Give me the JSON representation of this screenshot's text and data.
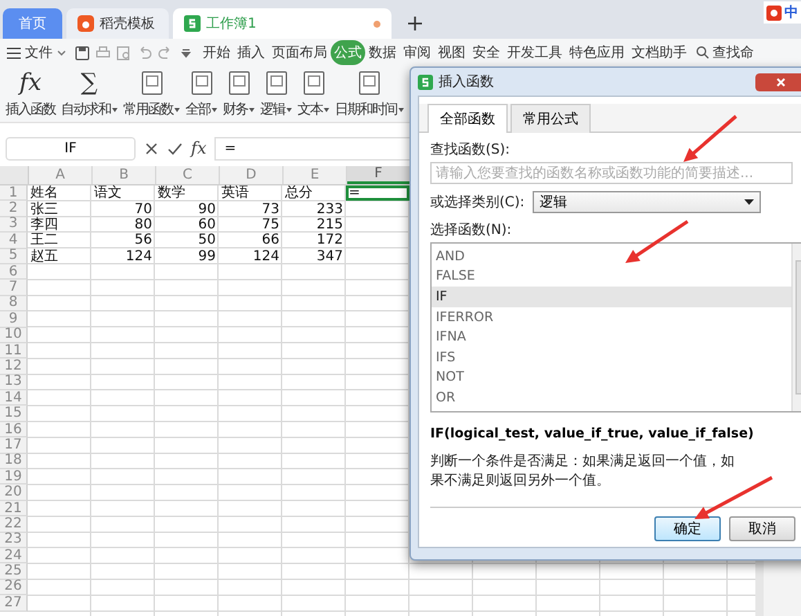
{
  "tabs": [
    {
      "label": "首页",
      "selected": false,
      "kind": "home"
    },
    {
      "label": "稻壳模板",
      "selected": false,
      "kind": "docer"
    },
    {
      "label": "工作簿1",
      "selected": true,
      "kind": "sheet"
    }
  ],
  "ime_label": "中",
  "menu": {
    "file": "文件",
    "items": [
      {
        "label": "开始",
        "selected": false
      },
      {
        "label": "插入",
        "selected": false
      },
      {
        "label": "页面布局",
        "selected": false
      },
      {
        "label": "公式",
        "selected": true
      },
      {
        "label": "数据",
        "selected": false
      },
      {
        "label": "审阅",
        "selected": false
      },
      {
        "label": "视图",
        "selected": false
      },
      {
        "label": "安全",
        "selected": false
      },
      {
        "label": "开发工具",
        "selected": false
      },
      {
        "label": "特色应用",
        "selected": false
      },
      {
        "label": "文档助手",
        "selected": false
      }
    ],
    "search": "查找命"
  },
  "ribbon": [
    {
      "label": "插入函数",
      "kind": "glyph",
      "glyph": "fx",
      "dropdown": false
    },
    {
      "label": "自动求和",
      "kind": "glyph",
      "glyph": "∑",
      "dropdown": true
    },
    {
      "label": "常用函数",
      "kind": "doc",
      "dropdown": true
    },
    {
      "label": "全部",
      "kind": "doc",
      "dropdown": true
    },
    {
      "label": "财务",
      "kind": "doc",
      "dropdown": true
    },
    {
      "label": "逻辑",
      "kind": "doc",
      "dropdown": true
    },
    {
      "label": "文本",
      "kind": "doc",
      "dropdown": true
    },
    {
      "label": "日期和时间",
      "kind": "doc",
      "dropdown": true
    }
  ],
  "formula_bar": {
    "name_box": "IF",
    "fx": "fx",
    "value": "="
  },
  "sheet": {
    "columns": [
      {
        "label": "A",
        "selected": false
      },
      {
        "label": "B",
        "selected": false
      },
      {
        "label": "C",
        "selected": false
      },
      {
        "label": "D",
        "selected": false
      },
      {
        "label": "E",
        "selected": false
      },
      {
        "label": "F",
        "selected": true
      }
    ],
    "rows": [
      {
        "number": "1",
        "kind": "text",
        "cells": [
          {
            "text": "姓名",
            "selected": false
          },
          {
            "text": "语文",
            "selected": false
          },
          {
            "text": "数学",
            "selected": false
          },
          {
            "text": "英语",
            "selected": false
          },
          {
            "text": "总分",
            "selected": false
          },
          {
            "text": "=",
            "selected": true
          }
        ]
      },
      {
        "number": "2",
        "kind": "record",
        "cells": [
          {
            "text": "张三",
            "selected": false
          },
          {
            "text": "70",
            "selected": false
          },
          {
            "text": "90",
            "selected": false
          },
          {
            "text": "73",
            "selected": false
          },
          {
            "text": "233",
            "selected": false
          }
        ]
      },
      {
        "number": "3",
        "kind": "record",
        "cells": [
          {
            "text": "李四",
            "selected": false
          },
          {
            "text": "80",
            "selected": false
          },
          {
            "text": "60",
            "selected": false
          },
          {
            "text": "75",
            "selected": false
          },
          {
            "text": "215",
            "selected": false
          }
        ]
      },
      {
        "number": "4",
        "kind": "record",
        "cells": [
          {
            "text": "王二",
            "selected": false
          },
          {
            "text": "56",
            "selected": false
          },
          {
            "text": "50",
            "selected": false
          },
          {
            "text": "66",
            "selected": false
          },
          {
            "text": "172",
            "selected": false
          }
        ]
      },
      {
        "number": "5",
        "kind": "record",
        "cells": [
          {
            "text": "赵五",
            "selected": false
          },
          {
            "text": "124",
            "selected": false
          },
          {
            "text": "99",
            "selected": false
          },
          {
            "text": "124",
            "selected": false
          },
          {
            "text": "347",
            "selected": false
          }
        ]
      },
      {
        "number": "6"
      },
      {
        "number": "7"
      },
      {
        "number": "8"
      },
      {
        "number": "9"
      },
      {
        "number": "10"
      },
      {
        "number": "11"
      },
      {
        "number": "12"
      },
      {
        "number": "13"
      },
      {
        "number": "14"
      },
      {
        "number": "15"
      },
      {
        "number": "16"
      },
      {
        "number": "17"
      },
      {
        "number": "18"
      },
      {
        "number": "19"
      },
      {
        "number": "20"
      },
      {
        "number": "21"
      },
      {
        "number": "22"
      },
      {
        "number": "23"
      },
      {
        "number": "24"
      },
      {
        "number": "25"
      },
      {
        "number": "26"
      },
      {
        "number": "27"
      }
    ]
  },
  "dialog": {
    "title": "插入函数",
    "tabs": [
      {
        "label": "全部函数",
        "selected": true
      },
      {
        "label": "常用公式",
        "selected": false
      }
    ],
    "search_label": "查找函数(S):",
    "search": {
      "placeholder": "请输入您要查找的函数名称或函数功能的简要描述..."
    },
    "category_label": "或选择类别(C):",
    "category": "逻辑",
    "list_label": "选择函数(N):",
    "functions": [
      {
        "name": "AND",
        "selected": false
      },
      {
        "name": "FALSE",
        "selected": false
      },
      {
        "name": "IF",
        "selected": true
      },
      {
        "name": "IFERROR",
        "selected": false
      },
      {
        "name": "IFNA",
        "selected": false
      },
      {
        "name": "IFS",
        "selected": false
      },
      {
        "name": "NOT",
        "selected": false
      },
      {
        "name": "OR",
        "selected": false
      }
    ],
    "signature": "IF(logical_test, value_if_true, value_if_false)",
    "description": "判断一个条件是否满足：如果满足返回一个值，如果不满足则返回另外一个值。",
    "buttons": [
      {
        "label": "确定",
        "kind": "primary"
      },
      {
        "label": "取消",
        "kind": "secondary"
      }
    ]
  }
}
